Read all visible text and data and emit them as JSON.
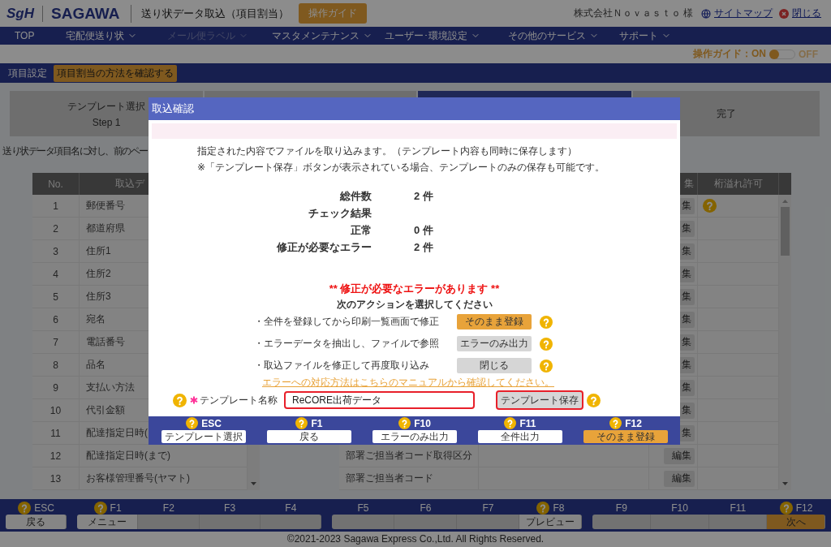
{
  "header": {
    "logo": "SgH",
    "brand": "SAGAWA",
    "title": "送り状データ取込（項目割当）",
    "guide_button": "操作ガイド",
    "company": "株式会社Ｎｏｖａｓｔｏ 様",
    "sitemap": "サイトマップ",
    "close": "閉じる"
  },
  "nav": [
    {
      "label": "TOP",
      "dropdown": false,
      "disabled": false
    },
    {
      "label": "宅配便送り状",
      "dropdown": true,
      "disabled": false
    },
    {
      "label": "メール便ラベル",
      "dropdown": true,
      "disabled": true
    },
    {
      "label": "マスタメンテナンス",
      "dropdown": true,
      "disabled": false
    },
    {
      "label": "ユーザー･環境設定",
      "dropdown": true,
      "disabled": false
    },
    {
      "label": "その他のサービス",
      "dropdown": true,
      "disabled": false
    },
    {
      "label": "サポート",
      "dropdown": true,
      "disabled": false
    }
  ],
  "guide_toggle": {
    "label": "操作ガイド：ON",
    "on": true,
    "off_label": "OFF"
  },
  "section": {
    "title": "項目設定",
    "help_badge": "項目割当の方法を確認する"
  },
  "steps": [
    {
      "label": "テンプレート選択",
      "sub": "Step 1",
      "selected": false
    },
    {
      "selected": false
    },
    {
      "selected": true
    },
    {
      "label": "完了",
      "selected": false
    }
  ],
  "description": "送り状データ項目名に対し、前のペー",
  "left_table": {
    "columns": [
      "No.",
      "取込デ"
    ],
    "rows": [
      {
        "no": "1",
        "name": "郵便番号"
      },
      {
        "no": "2",
        "name": "都道府県"
      },
      {
        "no": "3",
        "name": "住所1"
      },
      {
        "no": "4",
        "name": "住所2"
      },
      {
        "no": "5",
        "name": "住所3"
      },
      {
        "no": "6",
        "name": "宛名"
      },
      {
        "no": "7",
        "name": "電話番号"
      },
      {
        "no": "8",
        "name": "品名"
      },
      {
        "no": "9",
        "name": "支払い方法"
      },
      {
        "no": "10",
        "name": "代引金額"
      },
      {
        "no": "11",
        "name": "配達指定日時("
      },
      {
        "no": "12",
        "name": "配達指定日時(まで)"
      },
      {
        "no": "13",
        "name": "お客様管理番号(ヤマト)"
      }
    ]
  },
  "right_table": {
    "columns": [
      "集",
      "桁溢れ許可"
    ],
    "rows": [
      {
        "edit": "集",
        "help": true
      },
      {
        "edit": "集",
        "help": false
      },
      {
        "edit": "集",
        "help": false
      },
      {
        "edit": "集",
        "help": false
      },
      {
        "edit": "集",
        "help": false
      },
      {
        "edit": "集",
        "help": false
      },
      {
        "edit": "集",
        "help": false
      },
      {
        "edit": "集",
        "help": false
      },
      {
        "edit": "集",
        "help": false
      },
      {
        "edit": "集",
        "help": false
      },
      {
        "edit": "集",
        "help": false
      },
      {
        "field": "部署ご担当者コード取得区分",
        "edit": "編集",
        "help": false
      },
      {
        "field": "部署ご担当者コード",
        "edit": "編集",
        "help": false
      }
    ]
  },
  "function_keys": [
    [
      {
        "key": "ESC",
        "label": "戻る",
        "help": true,
        "primary": false
      }
    ],
    [
      {
        "key": "F1",
        "label": "メニュー",
        "help": true,
        "primary": false
      },
      {
        "key": "F2",
        "help": false,
        "primary": false
      },
      {
        "key": "F3",
        "help": false,
        "primary": false
      },
      {
        "key": "F4",
        "help": false,
        "primary": false
      }
    ],
    [
      {
        "key": "F5",
        "help": false,
        "primary": false
      },
      {
        "key": "F6",
        "help": false,
        "primary": false
      },
      {
        "key": "F7",
        "help": false,
        "primary": false
      },
      {
        "key": "F8",
        "label": "プレビュー",
        "help": true,
        "primary": false
      }
    ],
    [
      {
        "key": "F9",
        "help": false,
        "primary": false
      },
      {
        "key": "F10",
        "help": false,
        "primary": false
      },
      {
        "key": "F11",
        "help": false,
        "primary": false
      },
      {
        "key": "F12",
        "label": "次へ",
        "help": true,
        "primary": true
      }
    ]
  ],
  "footer": "©2021-2023 Sagawa Express Co.,Ltd. All Rights Reserved.",
  "dialog": {
    "title": "取込確認",
    "intro": [
      "指定された内容でファイルを取り込みます。（テンプレート内容も同時に保存します）",
      "※「テンプレート保存」ボタンが表示されている場合、テンプレートのみの保存も可能です。"
    ],
    "summary": [
      {
        "label": "総件数",
        "value": "2 件"
      },
      {
        "label": "チェック結果"
      },
      {
        "label": "正常",
        "value": "0 件"
      },
      {
        "label": "修正が必要なエラー",
        "value": "2 件"
      }
    ],
    "alert": "** 修正が必要なエラーがあります **",
    "prompt": "次のアクションを選択してください",
    "actions": [
      {
        "text": "・全件を登録してから印刷一覧画面で修正",
        "button": "そのまま登録",
        "primary": true
      },
      {
        "text": "・エラーデータを抽出し、ファイルで参照",
        "button": "エラーのみ出力",
        "primary": false
      },
      {
        "text": "・取込ファイルを修正して再度取り込み",
        "button": "閉じる",
        "primary": false
      }
    ],
    "manual_link": "エラーへの対応方法はこちらのマニュアルから確認してください。",
    "template": {
      "label": "テンプレート名称",
      "required": true,
      "value": "ReCORE出荷データ",
      "save_button": "テンプレート保存"
    },
    "keys": [
      {
        "key": "ESC",
        "label": "テンプレート選択",
        "primary": false
      },
      {
        "key": "F1",
        "label": "戻る",
        "primary": false
      },
      {
        "key": "F10",
        "label": "エラーのみ出力",
        "primary": false
      },
      {
        "key": "F11",
        "label": "全件出力",
        "primary": false
      },
      {
        "key": "F12",
        "label": "そのまま登録",
        "primary": true
      }
    ]
  }
}
